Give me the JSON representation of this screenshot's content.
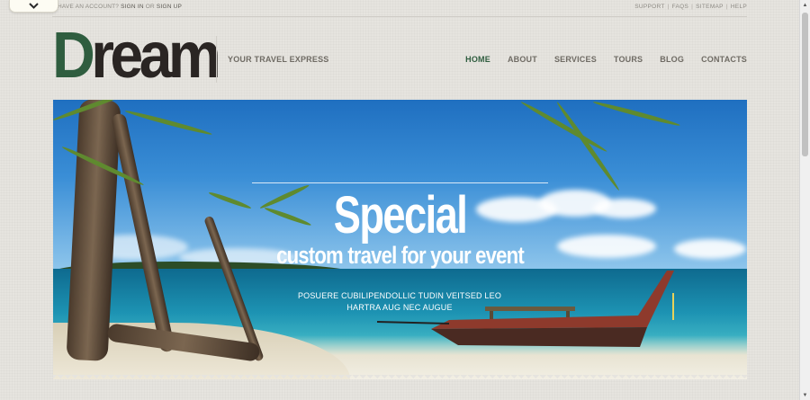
{
  "topbar": {
    "account_prefix": "HAVE AN ACCOUNT?",
    "sign_in": "SIGN IN",
    "or": "OR",
    "sign_up": "SIGN UP",
    "links": [
      "SUPPORT",
      "FAQS",
      "SITEMAP",
      "HELP"
    ]
  },
  "toggle": {
    "icon": "chevron-down-icon"
  },
  "header": {
    "logo_first": "D",
    "logo_rest": "ream",
    "tagline": "YOUR TRAVEL EXPRESS",
    "nav": [
      "HOME",
      "ABOUT",
      "SERVICES",
      "TOURS",
      "BLOG",
      "CONTACTS"
    ],
    "active_nav": "HOME"
  },
  "hero": {
    "title": "Special",
    "subtitle": "custom travel for your event",
    "body_line1": "POSUERE CUBILIPENDOLLIC TUDIN VEITSED LEO",
    "body_line2": "HARTRA AUG NEC AUGUE"
  },
  "colors": {
    "brand_green": "#2f5d3f",
    "logo_dark": "#2a2523",
    "nav_text": "#6f6b64",
    "background": "#e6e4df"
  }
}
